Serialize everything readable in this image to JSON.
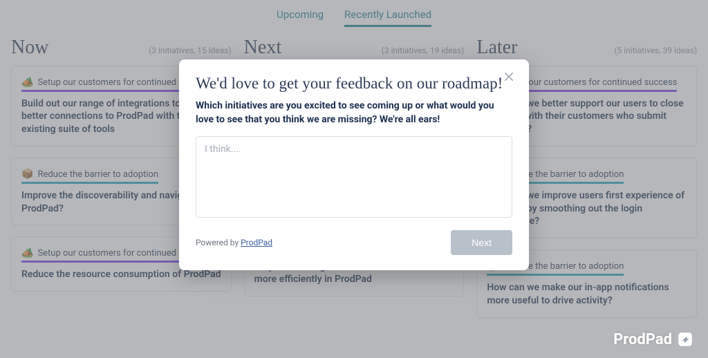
{
  "tabs": {
    "upcoming": "Upcoming",
    "recent": "Recently Launched"
  },
  "columns": {
    "now": {
      "title": "Now",
      "sub": "(3 initiatives, 15 ideas)"
    },
    "next": {
      "title": "Next",
      "sub": "(3 initiatives, 19 ideas)"
    },
    "later": {
      "title": "Later",
      "sub": "(5 initiatives, 39 ideas)"
    }
  },
  "tags": {
    "success": {
      "icon": "🏕️",
      "label": "Setup our customers for continued success"
    },
    "barrier": {
      "icon": "📦",
      "label": "Reduce the barrier to adoption"
    }
  },
  "cards": {
    "now1": "Build out our range of integrations to offer better connections to ProdPad with teams existing suite of tools",
    "now2": "Improve the discoverability and navigability of ProdPad?",
    "now3": "Reduce the resource consumption of ProdPad",
    "next2": "Help our users generate and link content more efficiently in ProdPad",
    "later1": "How can we better support our users to close the loop with their customers who submit feedback?",
    "later2": "How can we improve users first experience of ProdPad by smoothing out the login experience?",
    "later3": "How can we make our in-app notifications more useful to drive activity?"
  },
  "modal": {
    "title": "We'd love to get your feedback on our roadmap!",
    "question": "Which initiatives are you excited to see coming up or what would you love to see that you think we are missing? We're all ears!",
    "placeholder": "I think....",
    "powered_prefix": "Powered by ",
    "powered_link": "ProdPad",
    "next": "Next"
  },
  "brand": "ProdPad"
}
